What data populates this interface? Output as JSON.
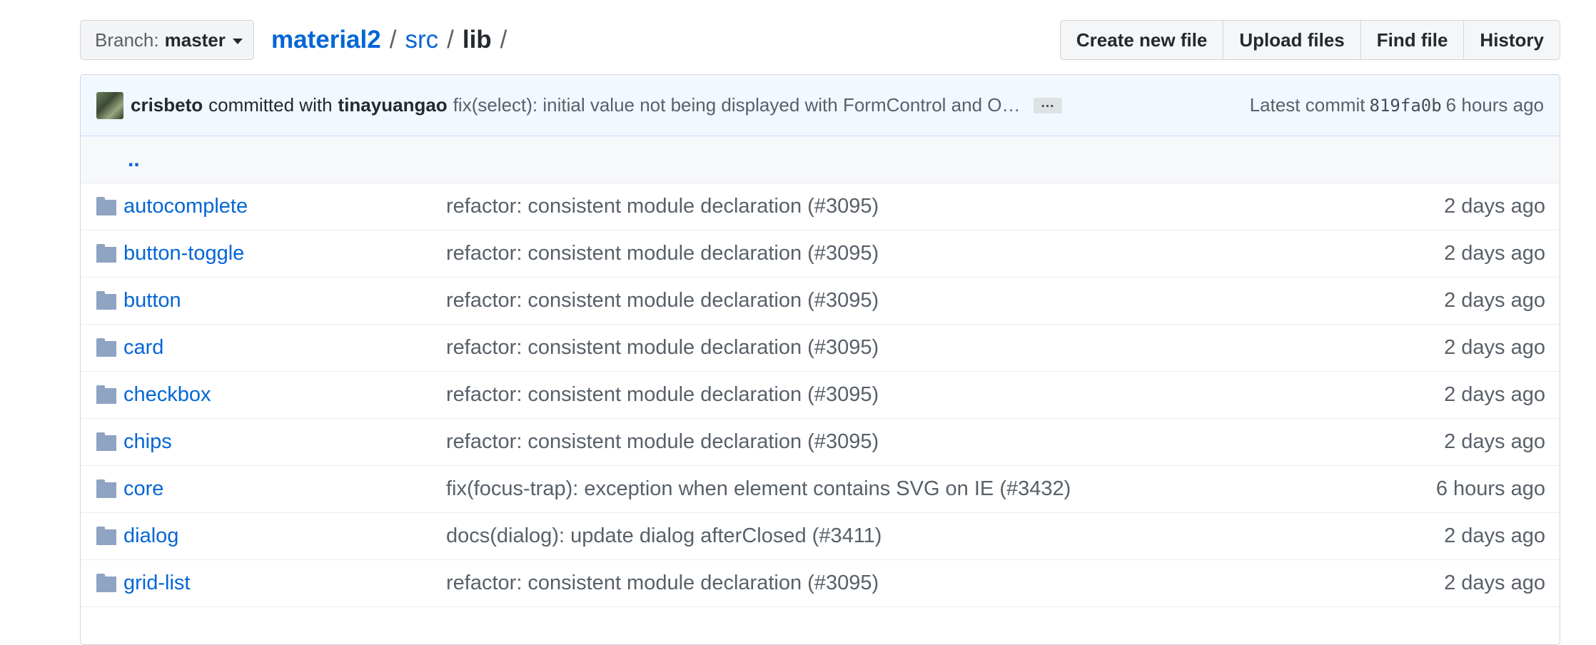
{
  "branch": {
    "label": "Branch:",
    "value": "master"
  },
  "breadcrumb": {
    "root": "material2",
    "sep1": "/",
    "src": "src",
    "sep2": "/",
    "current": "lib",
    "sep3": "/"
  },
  "buttons": {
    "create": "Create new file",
    "upload": "Upload files",
    "find": "Find file",
    "history": "History"
  },
  "commit": {
    "author": "crisbeto",
    "mid": "committed with",
    "coauthor": "tinayuangao",
    "message": "fix(select): initial value not being displayed with FormControl and O…",
    "ellipsis": "…",
    "latest_label": "Latest commit",
    "sha": "819fa0b",
    "age": "6 hours ago"
  },
  "up": "..",
  "rows": [
    {
      "name": "autocomplete",
      "message": "refactor: consistent module declaration (#3095)",
      "age": "2 days ago"
    },
    {
      "name": "button-toggle",
      "message": "refactor: consistent module declaration (#3095)",
      "age": "2 days ago"
    },
    {
      "name": "button",
      "message": "refactor: consistent module declaration (#3095)",
      "age": "2 days ago"
    },
    {
      "name": "card",
      "message": "refactor: consistent module declaration (#3095)",
      "age": "2 days ago"
    },
    {
      "name": "checkbox",
      "message": "refactor: consistent module declaration (#3095)",
      "age": "2 days ago"
    },
    {
      "name": "chips",
      "message": "refactor: consistent module declaration (#3095)",
      "age": "2 days ago"
    },
    {
      "name": "core",
      "message": "fix(focus-trap): exception when element contains SVG on IE (#3432)",
      "age": "6 hours ago"
    },
    {
      "name": "dialog",
      "message": "docs(dialog): update dialog afterClosed (#3411)",
      "age": "2 days ago"
    },
    {
      "name": "grid-list",
      "message": "refactor: consistent module declaration (#3095)",
      "age": "2 days ago"
    }
  ]
}
